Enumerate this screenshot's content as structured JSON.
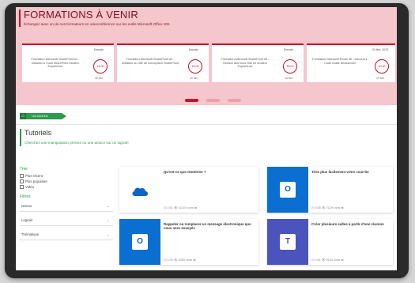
{
  "banner": {
    "title": "FORMATIONS À VENIR",
    "subtitle": "Échangez avec un de nos formateurs en visioconférence sur les outils Microsoft Office 365"
  },
  "events": [
    {
      "title": "Formation Microsoft SharePoint #1 - Initiation à l'outil SharePoint Modern Experience",
      "date": "Demain",
      "time": "14:00",
      "duration": "45 Min"
    },
    {
      "title": "Formation Microsoft SharePoint #2 - Initiation au rôle de concepteur SharePoint",
      "date": "Demain",
      "time": "10:00",
      "duration": "45 Min"
    },
    {
      "title": "Formation Microsoft SharePoint #3 - Gestion des hubs Site en Modern Experience",
      "date": "Demain",
      "time": "16:00",
      "duration": "45 Min"
    },
    {
      "title": "Formation Microsoft Power BI - Découvrir l'outil d'aide décisionnel",
      "date": "20 févr. 2023",
      "time": "10:00",
      "duration": "45 Min"
    }
  ],
  "breadcrumb": {
    "home_icon": "home-icon",
    "label": "Les tutoriels"
  },
  "tutorials": {
    "title": "Tutoriels",
    "subtitle": "Cherchez une manipulation précise ou une astuce sur un logiciel"
  },
  "filters": {
    "sort_label": "Trier",
    "sort_options": [
      "Plus récent",
      "Plus populaire",
      "Vidéo"
    ],
    "filter_label": "Filtres",
    "selects": [
      "Niveau",
      "Logiciel",
      "Thématique"
    ]
  },
  "cards": [
    {
      "title": "Qu'est-ce que OneDrive ?",
      "meta": "◷ 1:51  👁 11149 vues  ⇆",
      "icon": "onedrive-cloud-icon",
      "bg": "#ffffff",
      "color": "#0a66c2"
    },
    {
      "title": "Triez plus facilement votre courrier",
      "meta": "◷ 0:35  👁 7129 vues  ⇆",
      "icon": "outlook-icon",
      "bg": "#0a6fd1",
      "color": "#0b5db3"
    },
    {
      "title": "Rappeler ou remplacer un message électronique que vous avez envoyés",
      "meta": "◷ 1:00  👁 5350 vues  ⇆",
      "icon": "outlook-icon",
      "bg": "#0a6fd1",
      "color": "#0b5db3"
    },
    {
      "title": "Créer plusieurs salles à partir d'une réunion",
      "meta": "◷ 0:51  👁 9150 vues  ⇆",
      "icon": "teams-icon",
      "bg": "#4b53bc",
      "color": "#464eb8"
    }
  ],
  "colors": {
    "accent": "#c8102e",
    "green": "#2d9b4e"
  }
}
